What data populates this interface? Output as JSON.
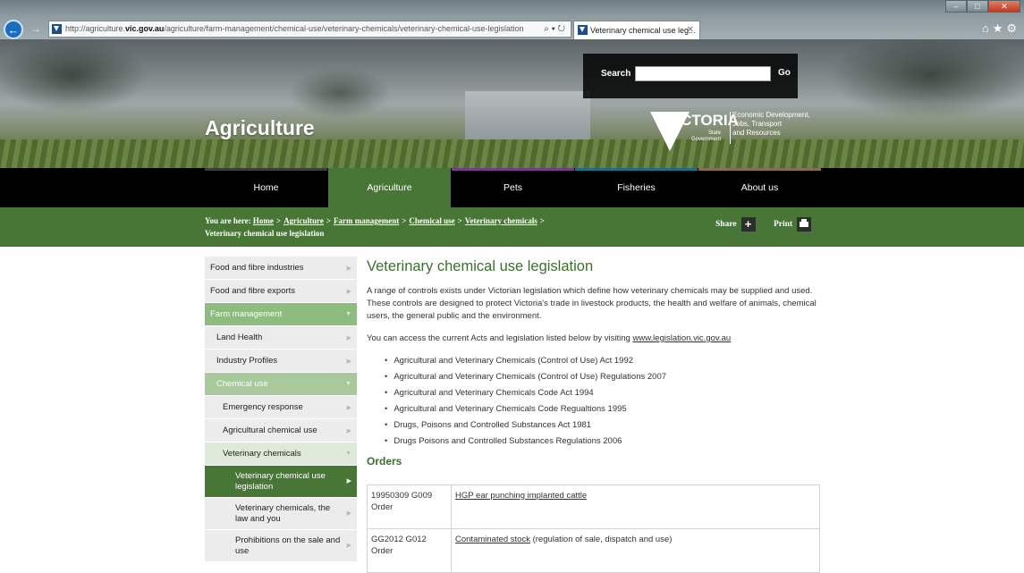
{
  "browser": {
    "url_prefix": "http://agriculture.",
    "url_domain": "vic.gov.au",
    "url_path": "/agriculture/farm-management/chemical-use/veterinary-chemicals/veterinary-chemical-use-legislation",
    "tab_title": "Veterinary chemical use leg...",
    "address_icons": "⌕ ▾ ↻"
  },
  "header": {
    "site_title": "Agriculture",
    "search_label": "Search",
    "search_placeholder": "",
    "search_go": "Go",
    "logo_word": "VICTORIA",
    "logo_sub": "State Government",
    "dept_line1": "Economic Development,",
    "dept_line2": "Jobs, Transport",
    "dept_line3": "and Resources"
  },
  "nav": {
    "items": [
      {
        "label": "Home",
        "color": "#3d3d3d"
      },
      {
        "label": "Agriculture",
        "color": "#487637"
      },
      {
        "label": "Pets",
        "color": "#7a3a8c"
      },
      {
        "label": "Fisheries",
        "color": "#1c6f85"
      },
      {
        "label": "About us",
        "color": "#8a6a52"
      }
    ]
  },
  "breadcrumb": {
    "prefix": "You are here:",
    "links": [
      "Home",
      "Agriculture",
      "Farm management",
      "Chemical use",
      "Veterinary chemicals"
    ],
    "current": "Veterinary chemical use legislation",
    "share": "Share",
    "print": "Print"
  },
  "sidebar": {
    "items": [
      {
        "label": "Food and fibre industries"
      },
      {
        "label": "Food and fibre exports"
      },
      {
        "label": "Farm management"
      },
      {
        "label": "Land Health"
      },
      {
        "label": "Industry Profiles"
      },
      {
        "label": "Chemical use"
      },
      {
        "label": "Emergency response"
      },
      {
        "label": "Agricultural chemical use"
      },
      {
        "label": "Veterinary chemicals"
      },
      {
        "label": "Veterinary chemical use legislation"
      },
      {
        "label": "Veterinary chemicals, the law and you"
      },
      {
        "label": "Prohibitions on the sale and use"
      }
    ]
  },
  "main": {
    "title": "Veterinary chemical use legislation",
    "intro": "A range of controls exists under Victorian legislation which define how veterinary chemicals may be supplied and used. These controls are designed to protect Victoria's trade in livestock products, the health and welfare of animals, chemical users, the general public and the environment.",
    "access_text": "You can access the current Acts and legislation listed below by visiting ",
    "access_link": "www.legislation.vic.gov.au",
    "acts": [
      "Agricultural and Veterinary Chemicals (Control of Use) Act 1992",
      "Agricultural and Veterinary Chemicals (Control of Use) Regulations 2007",
      "Agricultural and Veterinary Chemicals Code Act 1994",
      "Agricultural and Veterinary Chemicals Code Regualtions 1995",
      "Drugs, Poisons and Controlled Substances Act 1981",
      "Drugs Poisons and Controlled Substances Regulations 2006"
    ],
    "orders_title": "Orders",
    "orders": [
      {
        "code": "19950309 G009 Order",
        "link": "HGP ear punching implanted cattle",
        "rest": ""
      },
      {
        "code": "GG2012 G012 Order",
        "link": "Contaminated stock",
        "rest": " (regulation of sale, dispatch and use)"
      }
    ]
  }
}
